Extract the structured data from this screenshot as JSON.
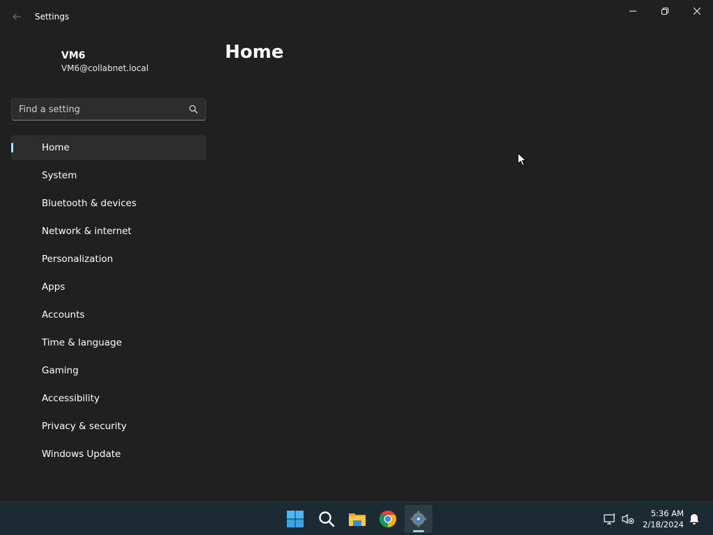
{
  "window": {
    "title": "Settings"
  },
  "profile": {
    "name": "VM6",
    "email": "VM6@collabnet.local"
  },
  "search": {
    "placeholder": "Find a setting"
  },
  "nav": {
    "selected": "Home",
    "items": [
      {
        "label": "Home",
        "icon": "home-icon"
      },
      {
        "label": "System",
        "icon": "system-icon"
      },
      {
        "label": "Bluetooth & devices",
        "icon": "bluetooth-icon"
      },
      {
        "label": "Network & internet",
        "icon": "network-icon"
      },
      {
        "label": "Personalization",
        "icon": "personalization-icon"
      },
      {
        "label": "Apps",
        "icon": "apps-icon"
      },
      {
        "label": "Accounts",
        "icon": "accounts-icon"
      },
      {
        "label": "Time & language",
        "icon": "time-language-icon"
      },
      {
        "label": "Gaming",
        "icon": "gaming-icon"
      },
      {
        "label": "Accessibility",
        "icon": "accessibility-icon"
      },
      {
        "label": "Privacy & security",
        "icon": "privacy-icon"
      },
      {
        "label": "Windows Update",
        "icon": "windows-update-icon"
      }
    ]
  },
  "main": {
    "title": "Home"
  },
  "taskbar": {
    "apps": [
      "start-icon",
      "search-icon",
      "file-explorer-icon",
      "chrome-icon",
      "settings-icon"
    ],
    "active_app": "settings-icon",
    "time": "5:36 AM",
    "date": "2/18/2024"
  },
  "colors": {
    "background": "#202020",
    "accent": "#99ebff",
    "taskbar": "#1c2b33"
  }
}
